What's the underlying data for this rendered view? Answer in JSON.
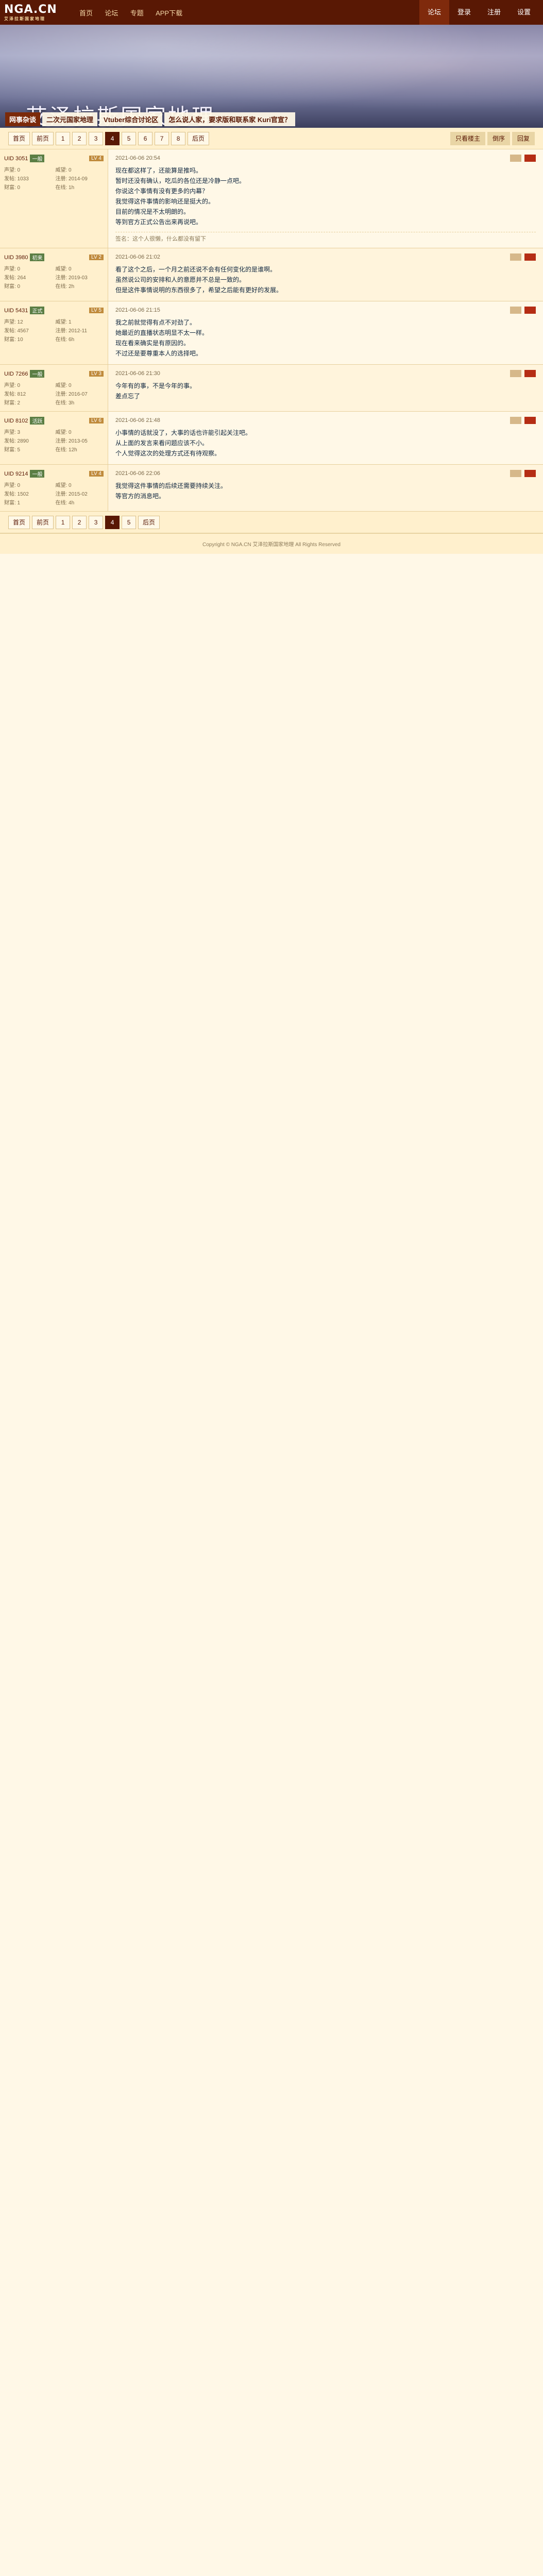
{
  "topbar": {
    "logo_main": "NGA.CN",
    "logo_sub": "艾泽拉斯国家地理",
    "nav": [
      "首页",
      "论坛",
      "专题",
      "APP下载"
    ],
    "right": [
      "登录",
      "注册",
      "设置"
    ],
    "active_right": "论坛"
  },
  "banner": {
    "title": "艾泽拉斯国家地理",
    "forum_tag": "网事杂谈",
    "thread_title": "二次元国家地理",
    "thread_sub": "Vtuber综合讨论区",
    "thread_subtitle": "怎么说人家，要求版和联系家 Kuri官宣？"
  },
  "pager": {
    "labels": [
      "首页",
      "前页",
      "1",
      "2",
      "3",
      "4",
      "5",
      "6",
      "7",
      "8",
      "后页"
    ],
    "current": "4",
    "right_buttons": [
      "只看楼主",
      "倒序",
      "回复"
    ]
  },
  "posts": [
    {
      "uid": "UID 3051",
      "badge": "一般",
      "level": "LV 4",
      "meta": [
        "声望: 0",
        "威望: 0",
        "发帖: 1033",
        "注册: 2014-09",
        "财富: 0",
        "在线: 1h"
      ],
      "time": "2021-06-06 20:54",
      "lines": [
        "现在都这样了，还能算是推吗。",
        "暂时还没有确认，吃瓜的各位还是冷静一点吧。",
        "你说这个事情有没有更多的内幕？",
        "",
        "我觉得这件事情的影响还是挺大的。",
        "目前的情况是不太明朗的。",
        "等到官方正式公告出来再说吧。"
      ],
      "sig": "签名：这个人很懒，什么都没有留下"
    },
    {
      "uid": "UID 3980",
      "badge": "初来",
      "level": "LV 2",
      "meta": [
        "声望: 0",
        "威望: 0",
        "发帖: 264",
        "注册: 2019-03",
        "财富: 0",
        "在线: 2h"
      ],
      "time": "2021-06-06 21:02",
      "lines": [
        "看了这个之后，一个月之前还说不会有任何变化的是谁啊。",
        "虽然说公司的安排和人的意愿并不总是一致的。",
        "但是这件事情说明的东西很多了，希望之后能有更好的发展。"
      ],
      "sig": ""
    },
    {
      "uid": "UID 5431",
      "badge": "正式",
      "level": "LV 5",
      "meta": [
        "声望: 12",
        "威望: 1",
        "发帖: 4567",
        "注册: 2012-11",
        "财富: 10",
        "在线: 6h"
      ],
      "time": "2021-06-06 21:15",
      "lines": [
        "我之前就觉得有点不对劲了。",
        "她最近的直播状态明显不太一样。",
        "现在看来确实是有原因的。",
        "不过还是要尊重本人的选择吧。"
      ],
      "sig": ""
    },
    {
      "uid": "UID 7266",
      "badge": "一般",
      "level": "LV 3",
      "meta": [
        "声望: 0",
        "威望: 0",
        "发帖: 812",
        "注册: 2016-07",
        "财富: 2",
        "在线: 3h"
      ],
      "time": "2021-06-06 21:30",
      "lines": [
        "今年有的事，不是今年的事。",
        "差点忘了"
      ],
      "sig": ""
    },
    {
      "uid": "UID 8102",
      "badge": "活跃",
      "level": "LV 6",
      "meta": [
        "声望: 3",
        "威望: 0",
        "发帖: 2890",
        "注册: 2013-05",
        "财富: 5",
        "在线: 12h"
      ],
      "time": "2021-06-06 21:48",
      "lines": [
        "小事情的话就没了，大事的话也许能引起关注吧。",
        "从上面的发言来看问题应该不小。",
        "个人觉得这次的处理方式还有待观察。"
      ],
      "sig": ""
    },
    {
      "uid": "UID 9214",
      "badge": "一般",
      "level": "LV 4",
      "meta": [
        "声望: 0",
        "威望: 0",
        "发帖: 1502",
        "注册: 2015-02",
        "财富: 1",
        "在线: 4h"
      ],
      "time": "2021-06-06 22:06",
      "lines": [
        "我觉得这件事情的后续还需要持续关注。",
        "等官方的消息吧。"
      ],
      "sig": ""
    }
  ],
  "footer": "Copyright © NGA.CN 艾泽拉斯国家地理 All Rights Reserved"
}
